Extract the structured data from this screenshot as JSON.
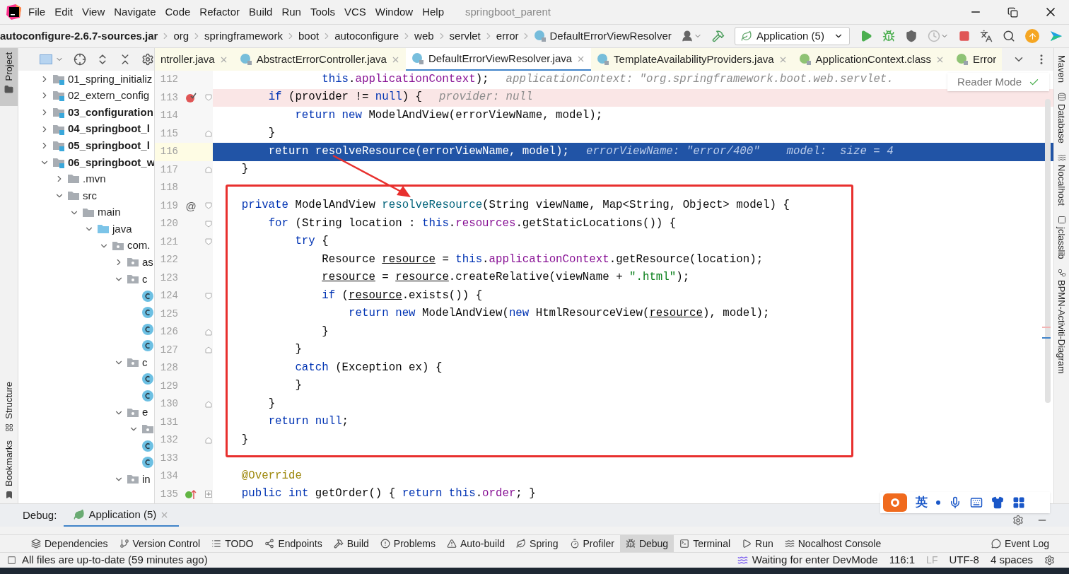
{
  "menu_bar": {
    "items": [
      "File",
      "Edit",
      "View",
      "Navigate",
      "Code",
      "Refactor",
      "Build",
      "Run",
      "Tools",
      "VCS",
      "Window",
      "Help"
    ],
    "title": "springboot_parent"
  },
  "breadcrumbs": [
    {
      "label": "autoconfigure-2.6.7-sources.jar",
      "kind": "jar"
    },
    {
      "label": "org",
      "kind": "folder"
    },
    {
      "label": "springframework",
      "kind": "folder"
    },
    {
      "label": "boot",
      "kind": "folder"
    },
    {
      "label": "autoconfigure",
      "kind": "folder"
    },
    {
      "label": "web",
      "kind": "folder"
    },
    {
      "label": "servlet",
      "kind": "folder"
    },
    {
      "label": "error",
      "kind": "folder"
    },
    {
      "label": "DefaultErrorViewResolver",
      "kind": "class"
    }
  ],
  "run_config": {
    "label": "Application (5)"
  },
  "left_strip": [
    {
      "label": "Project",
      "selected": true,
      "kind": "top"
    },
    {
      "label": "Structure",
      "selected": false,
      "kind": "bottom"
    },
    {
      "label": "Bookmarks",
      "selected": false,
      "kind": "bottom"
    }
  ],
  "project_tree": [
    {
      "label": "01_spring_initializ",
      "kind": "module",
      "bold": false,
      "expanded": false
    },
    {
      "label": "02_extern_config",
      "kind": "module",
      "bold": false,
      "expanded": false
    },
    {
      "label": "03_configuration",
      "kind": "module",
      "bold": true,
      "expanded": false
    },
    {
      "label": "04_springboot_l",
      "kind": "module",
      "bold": true,
      "expanded": false
    },
    {
      "label": "05_springboot_l",
      "kind": "module",
      "bold": true,
      "expanded": false
    },
    {
      "label": "06_springboot_w",
      "kind": "module",
      "bold": true,
      "expanded": true,
      "children": [
        {
          "label": ".mvn",
          "kind": "folder",
          "expanded": false
        },
        {
          "label": "src",
          "kind": "folder",
          "expanded": true,
          "children": [
            {
              "label": "main",
              "kind": "folder",
              "expanded": true,
              "children": [
                {
                  "label": "java",
                  "kind": "source",
                  "expanded": true,
                  "children": [
                    {
                      "label": "com.",
                      "kind": "package",
                      "expanded": true,
                      "children": [
                        {
                          "label": "as",
                          "kind": "package",
                          "expanded": false
                        },
                        {
                          "label": "c",
                          "kind": "package",
                          "expanded": true,
                          "children": [
                            {
                              "kind": "class"
                            },
                            {
                              "kind": "class"
                            },
                            {
                              "kind": "class"
                            },
                            {
                              "kind": "class"
                            }
                          ]
                        },
                        {
                          "label": "c",
                          "kind": "package",
                          "expanded": true,
                          "children": [
                            {
                              "kind": "class"
                            },
                            {
                              "kind": "class"
                            }
                          ]
                        },
                        {
                          "label": "e",
                          "kind": "package",
                          "expanded": true,
                          "children": [
                            {
                              "kind": "package",
                              "expanded": true
                            },
                            {
                              "kind": "class"
                            },
                            {
                              "kind": "class"
                            }
                          ]
                        },
                        {
                          "label": "in",
                          "kind": "package",
                          "expanded": true
                        }
                      ]
                    }
                  ]
                }
              ]
            }
          ]
        }
      ]
    }
  ],
  "editor_tabs": [
    {
      "label": "ntroller.java",
      "selected": false
    },
    {
      "label": "AbstractErrorController.java",
      "kind": "class",
      "selected": false
    },
    {
      "label": "DefaultErrorViewResolver.java",
      "kind": "class",
      "selected": true
    },
    {
      "label": "TemplateAvailabilityProviders.java",
      "kind": "class",
      "selected": false
    },
    {
      "label": "ApplicationContext.class",
      "kind": "interface",
      "selected": false
    },
    {
      "label": "Error",
      "kind": "interface",
      "selected": false
    }
  ],
  "reader_mode": {
    "label": "Reader Mode"
  },
  "code_lines": [
    {
      "number": "112",
      "selected": false,
      "breakpoint": false,
      "implements": false,
      "fold_start": false,
      "fold_end": false,
      "tokens": [
        {
          "t": "                this",
          "kind": "kw"
        },
        {
          "t": ".",
          "kind": "plain"
        },
        {
          "t": "applicationContext",
          "kind": "field"
        },
        {
          "t": ");",
          "kind": "plain"
        }
      ],
      "hint": "applicationContext: \"org.springframework.boot.web.servlet."
    },
    {
      "number": "113",
      "selected": false,
      "breakpoint": true,
      "implements": false,
      "fold_start": true,
      "fold_end": false,
      "tokens": [
        {
          "t": "        if",
          "kind": "kw"
        },
        {
          "t": " (provider != ",
          "kind": "plain"
        },
        {
          "t": "null",
          "kind": "kw"
        },
        {
          "t": ") {",
          "kind": "plain"
        }
      ],
      "hint": "provider: null"
    },
    {
      "number": "114",
      "selected": false,
      "breakpoint": false,
      "implements": false,
      "fold_start": false,
      "fold_end": false,
      "tokens": [
        {
          "t": "            return new",
          "kind": "kw"
        },
        {
          "t": " ModelAndView(errorViewName, model);",
          "kind": "plain"
        }
      ]
    },
    {
      "number": "115",
      "selected": false,
      "breakpoint": false,
      "implements": false,
      "fold_start": false,
      "fold_end": true,
      "tokens": [
        {
          "t": "        }",
          "kind": "plain"
        }
      ]
    },
    {
      "number": "116",
      "selected": true,
      "breakpoint": false,
      "implements": false,
      "fold_start": false,
      "fold_end": false,
      "tokens": [
        {
          "t": "        return resolveResource(errorViewName, model);"
        }
      ],
      "hint": "errorViewName: \"error/400\"    model:  size = 4"
    },
    {
      "number": "117",
      "selected": false,
      "breakpoint": false,
      "implements": false,
      "fold_start": false,
      "fold_end": true,
      "tokens": [
        {
          "t": "    }",
          "kind": "plain"
        }
      ]
    },
    {
      "number": "118",
      "selected": false,
      "breakpoint": false,
      "implements": false,
      "fold_start": false,
      "fold_end": false
    },
    {
      "number": "119",
      "selected": false,
      "breakpoint": false,
      "implements": false,
      "fold_start": true,
      "fold_end": false,
      "gutter_mark": "@",
      "tokens": [
        {
          "t": "    private",
          "kind": "kw"
        },
        {
          "t": " ModelAndView ",
          "kind": "plain"
        },
        {
          "t": "resolveResource",
          "kind": "decl"
        },
        {
          "t": "(String viewName, Map<String, Object> model) {",
          "kind": "plain"
        }
      ]
    },
    {
      "number": "120",
      "selected": false,
      "breakpoint": false,
      "implements": false,
      "fold_start": true,
      "fold_end": false,
      "tokens": [
        {
          "t": "        for",
          "kind": "kw"
        },
        {
          "t": " (String location : ",
          "kind": "plain"
        },
        {
          "t": "this",
          "kind": "kw"
        },
        {
          "t": ".",
          "kind": "plain"
        },
        {
          "t": "resources",
          "kind": "field"
        },
        {
          "t": ".getStaticLocations()) {",
          "kind": "plain"
        }
      ]
    },
    {
      "number": "121",
      "selected": false,
      "breakpoint": false,
      "implements": false,
      "fold_start": true,
      "fold_end": false,
      "tokens": [
        {
          "t": "            try",
          "kind": "kw"
        },
        {
          "t": " {",
          "kind": "plain"
        }
      ]
    },
    {
      "number": "122",
      "selected": false,
      "breakpoint": false,
      "implements": false,
      "fold_start": false,
      "fold_end": false,
      "tokens": [
        {
          "t": "                Resource ",
          "kind": "plain"
        },
        {
          "t": "resource",
          "kind": "var"
        },
        {
          "t": " = ",
          "kind": "plain"
        },
        {
          "t": "this",
          "kind": "kw"
        },
        {
          "t": ".",
          "kind": "plain"
        },
        {
          "t": "applicationContext",
          "kind": "field"
        },
        {
          "t": ".getResource(location);",
          "kind": "plain"
        }
      ]
    },
    {
      "number": "123",
      "selected": false,
      "breakpoint": false,
      "implements": false,
      "fold_start": false,
      "fold_end": false,
      "tokens": [
        {
          "t": "                resource",
          "kind": "var"
        },
        {
          "t": " = ",
          "kind": "plain"
        },
        {
          "t": "resource",
          "kind": "var"
        },
        {
          "t": ".createRelative(viewName + ",
          "kind": "plain"
        },
        {
          "t": "\".html\"",
          "kind": "str"
        },
        {
          "t": ");",
          "kind": "plain"
        }
      ]
    },
    {
      "number": "124",
      "selected": false,
      "breakpoint": false,
      "implements": false,
      "fold_start": true,
      "fold_end": false,
      "tokens": [
        {
          "t": "                if",
          "kind": "kw"
        },
        {
          "t": " (",
          "kind": "plain"
        },
        {
          "t": "resource",
          "kind": "var"
        },
        {
          "t": ".exists()) {",
          "kind": "plain"
        }
      ]
    },
    {
      "number": "125",
      "selected": false,
      "breakpoint": false,
      "implements": false,
      "fold_start": false,
      "fold_end": false,
      "tokens": [
        {
          "t": "                    return new",
          "kind": "kw"
        },
        {
          "t": " ModelAndView(",
          "kind": "plain"
        },
        {
          "t": "new",
          "kind": "kw"
        },
        {
          "t": " HtmlResourceView(",
          "kind": "plain"
        },
        {
          "t": "resource",
          "kind": "var"
        },
        {
          "t": "), model);",
          "kind": "plain"
        }
      ]
    },
    {
      "number": "126",
      "selected": false,
      "breakpoint": false,
      "implements": false,
      "fold_start": false,
      "fold_end": true,
      "tokens": [
        {
          "t": "                }",
          "kind": "plain"
        }
      ]
    },
    {
      "number": "127",
      "selected": false,
      "breakpoint": false,
      "implements": false,
      "fold_start": false,
      "fold_end": true,
      "tokens": [
        {
          "t": "            }",
          "kind": "plain"
        }
      ]
    },
    {
      "number": "128",
      "selected": false,
      "breakpoint": false,
      "implements": false,
      "fold_start": false,
      "fold_end": false,
      "tokens": [
        {
          "t": "            catch",
          "kind": "kw"
        },
        {
          "t": " (Exception ex) {",
          "kind": "plain"
        }
      ]
    },
    {
      "number": "129",
      "selected": false,
      "breakpoint": false,
      "implements": false,
      "fold_start": false,
      "fold_end": false,
      "tokens": [
        {
          "t": "            }",
          "kind": "plain"
        }
      ]
    },
    {
      "number": "130",
      "selected": false,
      "breakpoint": false,
      "implements": false,
      "fold_start": false,
      "fold_end": true,
      "tokens": [
        {
          "t": "        }",
          "kind": "plain"
        }
      ]
    },
    {
      "number": "131",
      "selected": false,
      "breakpoint": false,
      "implements": false,
      "fold_start": false,
      "fold_end": false,
      "tokens": [
        {
          "t": "        return null",
          "kind": "kw"
        },
        {
          "t": ";",
          "kind": "plain"
        }
      ]
    },
    {
      "number": "132",
      "selected": false,
      "breakpoint": false,
      "implements": false,
      "fold_start": false,
      "fold_end": true,
      "tokens": [
        {
          "t": "    }",
          "kind": "plain"
        }
      ]
    },
    {
      "number": "133",
      "selected": false,
      "breakpoint": false,
      "implements": false,
      "fold_start": false,
      "fold_end": false
    },
    {
      "number": "134",
      "selected": false,
      "breakpoint": false,
      "implements": false,
      "fold_start": false,
      "fold_end": false,
      "tokens": [
        {
          "t": "    @Override",
          "kind": "annotation"
        }
      ]
    },
    {
      "number": "135",
      "selected": false,
      "breakpoint": false,
      "implements": true,
      "fold_start": true,
      "fold_end": true,
      "tokens": [
        {
          "t": "    public int",
          "kind": "kw"
        },
        {
          "t": " getOrder() { ",
          "kind": "plain"
        },
        {
          "t": "return this",
          "kind": "kw"
        },
        {
          "t": ".",
          "kind": "plain"
        },
        {
          "t": "order",
          "kind": "field"
        },
        {
          "t": "; }",
          "kind": "plain"
        }
      ]
    }
  ],
  "right_strip": [
    {
      "label": "Maven",
      "kind": "maven"
    },
    {
      "label": "Database",
      "kind": "database"
    },
    {
      "label": "Nocalhost",
      "kind": "nocalhost"
    },
    {
      "label": "jclasslib",
      "kind": "jclasslib"
    },
    {
      "label": "BPMN-Activiti-Diagram",
      "kind": "bpmn"
    }
  ],
  "debug_panel": {
    "label": "Debug:",
    "tab": "Application (5)"
  },
  "ime_toolbar": {
    "label": "英"
  },
  "tool_windows": [
    {
      "label": "Dependencies",
      "kind": "dependencies",
      "selected": false
    },
    {
      "label": "Version Control",
      "kind": "vcs",
      "selected": false
    },
    {
      "label": "TODO",
      "kind": "todo",
      "selected": false
    },
    {
      "label": "Endpoints",
      "kind": "endpoints",
      "selected": false
    },
    {
      "label": "Build",
      "kind": "build",
      "selected": false
    },
    {
      "label": "Problems",
      "kind": "problems",
      "selected": false
    },
    {
      "label": "Auto-build",
      "kind": "autobuild",
      "selected": false
    },
    {
      "label": "Spring",
      "kind": "spring",
      "selected": false
    },
    {
      "label": "Profiler",
      "kind": "profiler",
      "selected": false
    },
    {
      "label": "Debug",
      "kind": "debug",
      "selected": true
    },
    {
      "label": "Terminal",
      "kind": "terminal",
      "selected": false
    },
    {
      "label": "Run",
      "kind": "run",
      "selected": false
    },
    {
      "label": "Nocalhost Console",
      "kind": "nocalhost",
      "selected": false
    },
    {
      "label": "Event Log",
      "kind": "eventlog",
      "selected": false
    }
  ],
  "status_bar": {
    "message": "All files are up-to-date (59 minutes ago)",
    "devmode": "Waiting for enter DevMode",
    "position": "116:1",
    "line_ending": "LF",
    "encoding": "UTF-8",
    "indent": "4 spaces"
  }
}
